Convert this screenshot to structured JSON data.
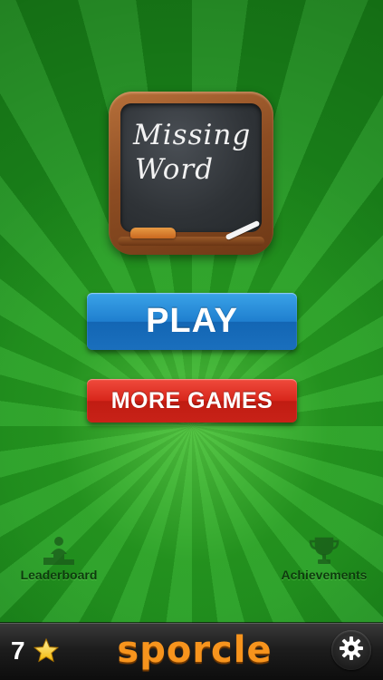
{
  "logo": {
    "line1": "Missing",
    "line2": "Word"
  },
  "buttons": {
    "play": "PLAY",
    "more_games": "MORE GAMES"
  },
  "bottom": {
    "leaderboard": "Leaderboard",
    "achievements": "Achievements"
  },
  "footer": {
    "stars": "7",
    "brand": "sporcle"
  },
  "colors": {
    "background_green": "#2ea02e",
    "play_blue": "#1f7fcf",
    "more_games_red": "#d8261b",
    "brand_orange": "#f7941d",
    "footer_black": "#1d1d1d"
  },
  "icons": {
    "leaderboard": "leaderboard-icon",
    "achievements": "trophy-icon",
    "stars": "star-icon",
    "settings": "gear-icon"
  }
}
